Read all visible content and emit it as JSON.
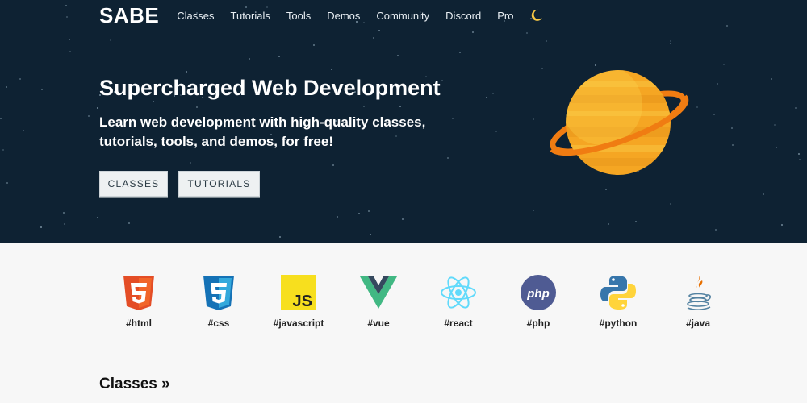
{
  "brand": {
    "logo": "SABE"
  },
  "nav": {
    "items": [
      "Classes",
      "Tutorials",
      "Tools",
      "Demos",
      "Community",
      "Discord",
      "Pro"
    ],
    "theme_icon": "moon-icon"
  },
  "hero": {
    "title": "Supercharged Web Development",
    "subtitle": "Learn web development with high-quality classes, tutorials, tools, and demos, for free!",
    "buttons": [
      "CLASSES",
      "TUTORIALS"
    ],
    "illustration": "planet-icon"
  },
  "languages": [
    {
      "label": "#html",
      "icon": "html5-icon"
    },
    {
      "label": "#css",
      "icon": "css3-icon"
    },
    {
      "label": "#javascript",
      "icon": "javascript-icon"
    },
    {
      "label": "#vue",
      "icon": "vue-icon"
    },
    {
      "label": "#react",
      "icon": "react-icon"
    },
    {
      "label": "#php",
      "icon": "php-icon"
    },
    {
      "label": "#python",
      "icon": "python-icon"
    },
    {
      "label": "#java",
      "icon": "java-icon"
    }
  ],
  "sections": {
    "classes_heading": "Classes »"
  },
  "colors": {
    "hero_bg": "#0e2233",
    "planet_orange": "#f5a623",
    "ring_orange": "#f07c12",
    "html_orange": "#e44d26",
    "css_blue": "#1572b6",
    "js_yellow": "#f7df1e",
    "vue_green": "#41b883",
    "react_cyan": "#61dafb",
    "php_purple": "#777bb3",
    "python_blue": "#3776ab",
    "python_yellow": "#ffd43b",
    "java_red": "#e76f00"
  }
}
